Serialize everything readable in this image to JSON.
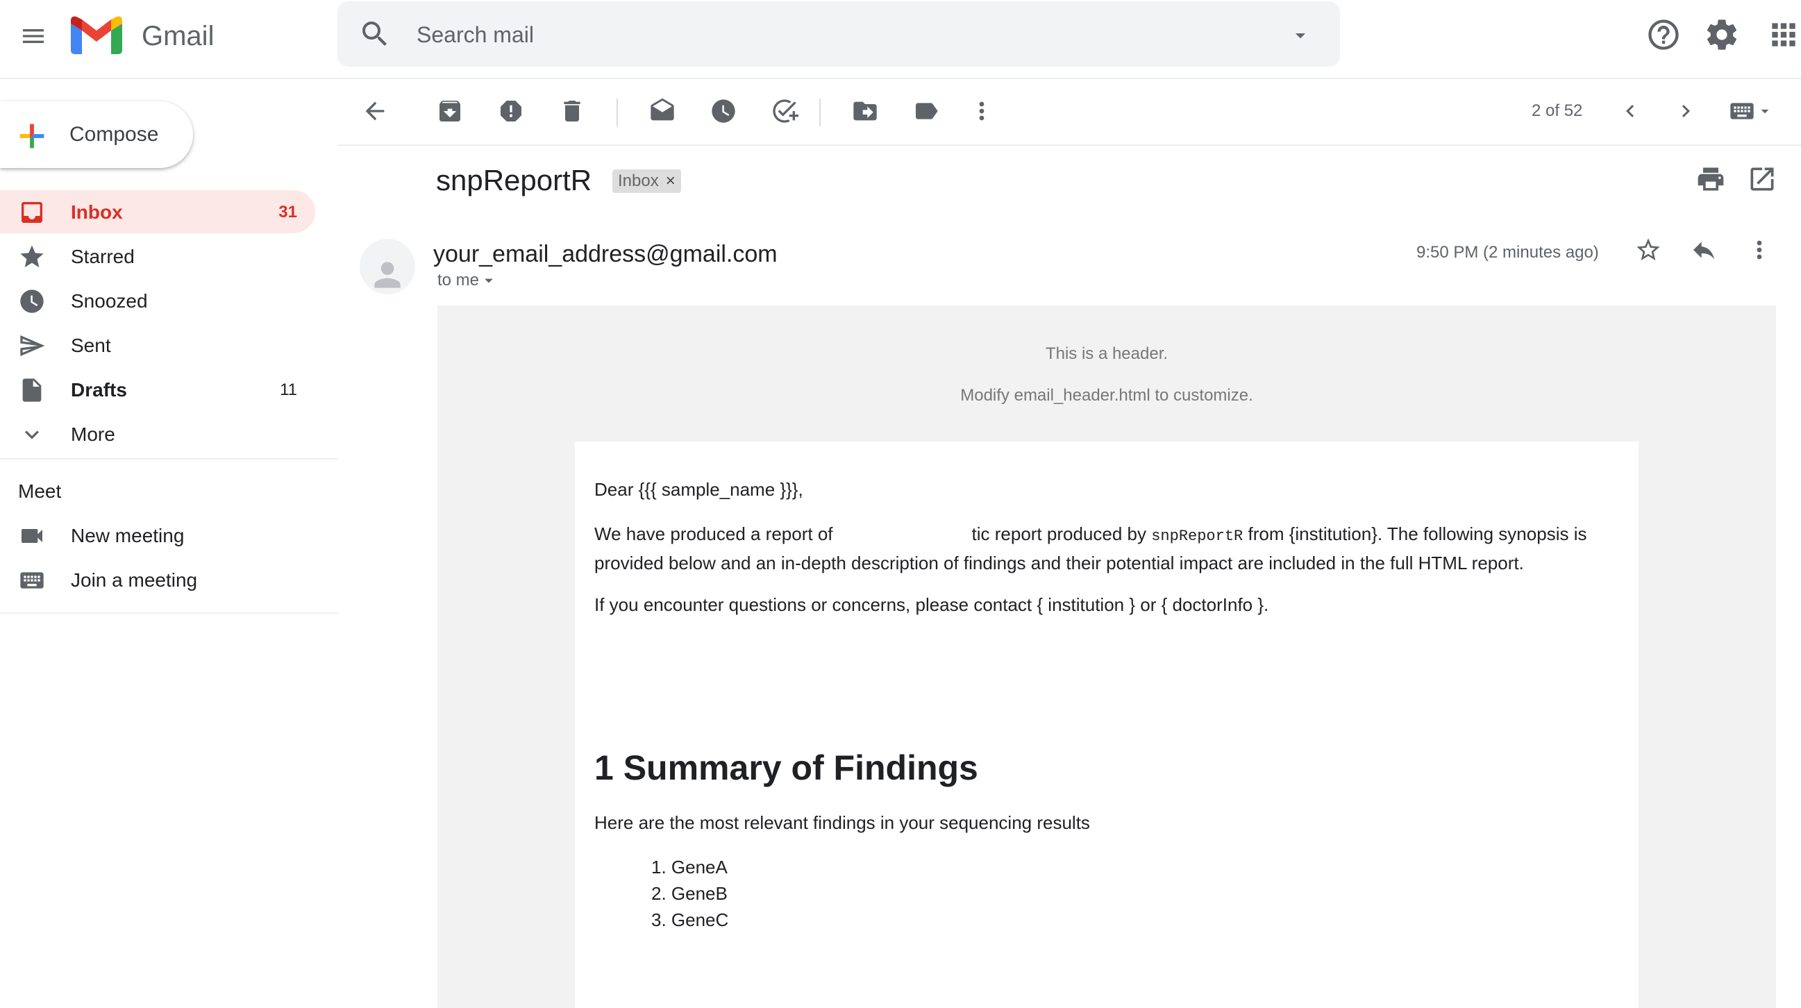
{
  "header": {
    "brand": "Gmail",
    "search_placeholder": "Search mail"
  },
  "sidebar": {
    "compose_label": "Compose",
    "items": [
      {
        "label": "Inbox",
        "count": "31"
      },
      {
        "label": "Starred"
      },
      {
        "label": "Snoozed"
      },
      {
        "label": "Sent"
      },
      {
        "label": "Drafts",
        "count": "11"
      },
      {
        "label": "More"
      }
    ],
    "meet": {
      "title": "Meet",
      "items": [
        {
          "label": "New meeting"
        },
        {
          "label": "Join a meeting"
        }
      ]
    }
  },
  "toolbar": {
    "pager": "2 of 52"
  },
  "message": {
    "subject": "snpReportR",
    "label_badge": "Inbox",
    "sender": "your_email_address@gmail.com",
    "to": "to me",
    "time": "9:50 PM (2 minutes ago)"
  },
  "email": {
    "header_line1": "This is a header.",
    "header_line2": "Modify email_header.html to customize.",
    "greeting": "Dear {{{ sample_name }}},",
    "p1_a": "We have produced a report of",
    "p1_b": "tic report produced by",
    "p1_code": "snpReportR",
    "p1_c": "from {institution}. The following synopsis is",
    "p1_d": "provided below and an in-depth description of findings and their potential impact are included in the full HTML report.",
    "p2": "If you encounter questions or concerns, please contact { institution } or { doctorInfo }.",
    "heading": "1 Summary of Findings",
    "intro": "Here are the most relevant findings in your sequencing results",
    "list": [
      "1. GeneA",
      "2. GeneB",
      "3. GeneC"
    ]
  },
  "colors": {
    "accent_red": "#d93025",
    "active_bg": "#fce8e6",
    "search_bg": "#f1f3f4",
    "icon_gray": "#5f6368"
  },
  "icons": {
    "menu": "hamburger-menu-icon",
    "search": "search-icon",
    "help": "help-icon",
    "settings": "gear-icon",
    "apps": "apps-grid-icon"
  }
}
